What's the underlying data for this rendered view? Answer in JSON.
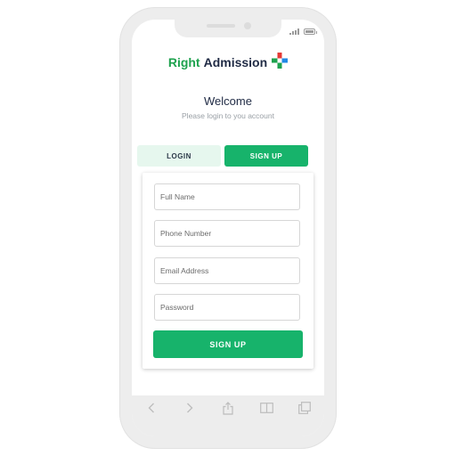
{
  "brand": {
    "word1": "Right",
    "word2": "Admission",
    "accent_green": "#1ea24e",
    "accent_red": "#e53935",
    "accent_blue": "#1e88e5"
  },
  "header": {
    "title": "Welcome",
    "subtitle": "Please login to you account"
  },
  "tabs": {
    "login": "LOGIN",
    "signup": "SIGN UP",
    "active": "signup"
  },
  "form": {
    "full_name_placeholder": "Full Name",
    "phone_placeholder": "Phone Number",
    "email_placeholder": "Email Address",
    "password_placeholder": "Password",
    "submit_label": "SIGN UP"
  },
  "toolbar": {
    "icons": [
      "back-icon",
      "forward-icon",
      "share-icon",
      "bookmarks-icon",
      "tabs-icon"
    ]
  },
  "colors": {
    "primary": "#17b36b",
    "tab_inactive_bg": "#e6f7ee",
    "text_dark": "#1f2a44",
    "text_muted": "#9aa0a6"
  }
}
